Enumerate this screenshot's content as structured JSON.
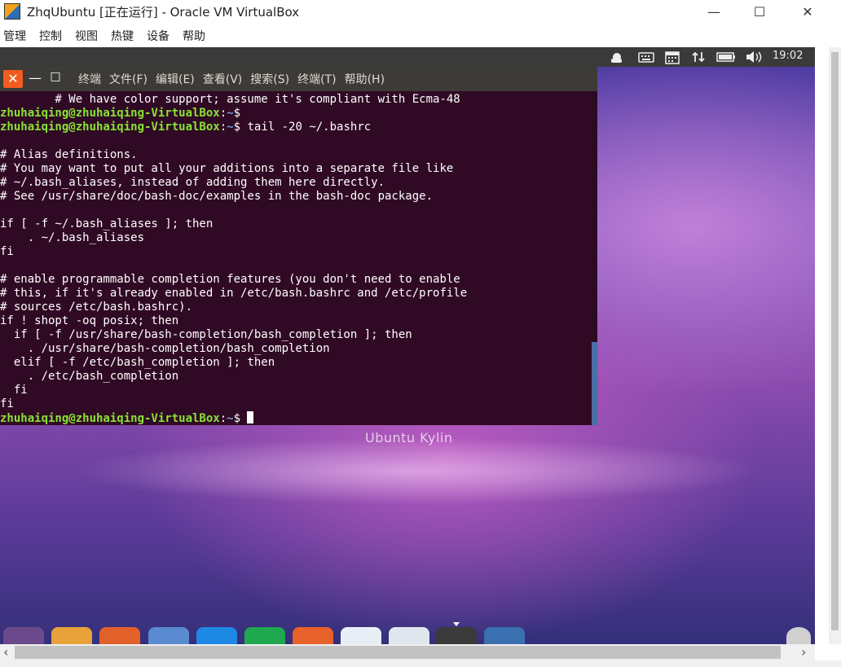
{
  "host": {
    "title": "ZhqUbuntu [正在运行] - Oracle VM VirtualBox",
    "controls": {
      "minimize": "—",
      "maximize": "☐",
      "close": "✕"
    },
    "menus": [
      "管理",
      "控制",
      "视图",
      "热键",
      "设备",
      "帮助"
    ]
  },
  "guest": {
    "clock": "19:02",
    "watermark": "Ubuntu Kylin",
    "tray_icons": [
      "weather-icon",
      "keyboard-icon",
      "calendar-icon",
      "network-icon",
      "battery-icon",
      "volume-icon"
    ]
  },
  "terminal": {
    "close_glyph": "✕",
    "min_glyph": "—",
    "max_glyph": "□",
    "menus": [
      "终端",
      "文件(F)",
      "编辑(E)",
      "查看(V)",
      "搜索(S)",
      "终端(T)",
      "帮助(H)"
    ],
    "prompt_user": "zhuhaiqing@zhuhaiqing-VirtualBox",
    "prompt_path": "~",
    "lines": [
      {
        "type": "text",
        "text": "        # We have color support; assume it's compliant with Ecma-48"
      },
      {
        "type": "prompt",
        "cmd": ""
      },
      {
        "type": "prompt",
        "cmd": " tail -20 ~/.bashrc"
      },
      {
        "type": "text",
        "text": ""
      },
      {
        "type": "text",
        "text": "# Alias definitions."
      },
      {
        "type": "text",
        "text": "# You may want to put all your additions into a separate file like"
      },
      {
        "type": "text",
        "text": "# ~/.bash_aliases, instead of adding them here directly."
      },
      {
        "type": "text",
        "text": "# See /usr/share/doc/bash-doc/examples in the bash-doc package."
      },
      {
        "type": "text",
        "text": ""
      },
      {
        "type": "text",
        "text": "if [ -f ~/.bash_aliases ]; then"
      },
      {
        "type": "text",
        "text": "    . ~/.bash_aliases"
      },
      {
        "type": "text",
        "text": "fi"
      },
      {
        "type": "text",
        "text": ""
      },
      {
        "type": "text",
        "text": "# enable programmable completion features (you don't need to enable"
      },
      {
        "type": "text",
        "text": "# this, if it's already enabled in /etc/bash.bashrc and /etc/profile"
      },
      {
        "type": "text",
        "text": "# sources /etc/bash.bashrc)."
      },
      {
        "type": "text",
        "text": "if ! shopt -oq posix; then"
      },
      {
        "type": "text",
        "text": "  if [ -f /usr/share/bash-completion/bash_completion ]; then"
      },
      {
        "type": "text",
        "text": "    . /usr/share/bash-completion/bash_completion"
      },
      {
        "type": "text",
        "text": "  elif [ -f /etc/bash_completion ]; then"
      },
      {
        "type": "text",
        "text": "    . /etc/bash_completion"
      },
      {
        "type": "text",
        "text": "  fi"
      },
      {
        "type": "text",
        "text": "fi"
      },
      {
        "type": "prompt",
        "cmd": " ",
        "cursor": true
      }
    ]
  },
  "dock": {
    "items": [
      {
        "name": "dash-home-icon",
        "color": "#6a4a8a"
      },
      {
        "name": "files-folder-icon",
        "color": "#e8a23a"
      },
      {
        "name": "firefox-icon",
        "color": "#e2602a"
      },
      {
        "name": "kylin-assistant-icon",
        "color": "#5a8ad0"
      },
      {
        "name": "wps-writer-icon",
        "color": "#1e88e5"
      },
      {
        "name": "wps-spreadsheet-icon",
        "color": "#1fa84f"
      },
      {
        "name": "wps-presentation-icon",
        "color": "#e8602a"
      },
      {
        "name": "software-center-icon",
        "color": "#e8eef5"
      },
      {
        "name": "settings-icon",
        "color": "#dfe6ee"
      },
      {
        "name": "terminal-icon",
        "color": "#3a3a3a"
      },
      {
        "name": "workspace-switcher-icon",
        "color": "#3a6fb0"
      },
      {
        "name": "trash-icon",
        "color": "#d0d0d0"
      }
    ]
  }
}
